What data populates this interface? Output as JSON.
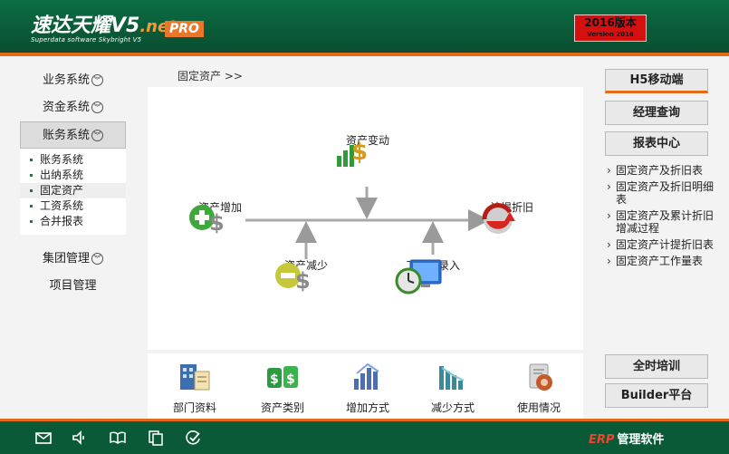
{
  "header": {
    "logo_main": "速达天耀V5",
    "logo_net": ".net",
    "logo_sub": "Superdata software Skybright V5",
    "pro_badge": "PRO",
    "version_title": "2016版本",
    "version_sub": "Version 2016"
  },
  "left_nav": {
    "items": [
      {
        "label": "业务系统"
      },
      {
        "label": "资金系统"
      },
      {
        "label": "账务系统"
      },
      {
        "label": "集团管理"
      },
      {
        "label": "项目管理"
      }
    ],
    "sub_items": [
      {
        "label": "账务系统"
      },
      {
        "label": "出纳系统"
      },
      {
        "label": "固定资产"
      },
      {
        "label": "工资系统"
      },
      {
        "label": "合并报表"
      }
    ]
  },
  "breadcrumb": "固定资产 >>",
  "flow": {
    "asset_change": "资产变动",
    "asset_increase": "资产增加",
    "depreciation": "计提折旧",
    "asset_decrease": "资产减少",
    "workload_entry": "工作量录入"
  },
  "tools": [
    {
      "label": "部门资料"
    },
    {
      "label": "资产类别"
    },
    {
      "label": "增加方式"
    },
    {
      "label": "减少方式"
    },
    {
      "label": "使用情况"
    }
  ],
  "right": {
    "h5_button": "H5移动端",
    "manager_button": "经理查询",
    "report_button": "报表中心",
    "links": [
      {
        "label": "固定资产及折旧表"
      },
      {
        "label": "固定资产及折旧明细表"
      },
      {
        "label": "固定资产及累计折旧增减过程"
      },
      {
        "label": "固定资产计提折旧表"
      },
      {
        "label": "固定资产工作量表"
      }
    ],
    "training_button": "全时培训",
    "builder_button": "Builder平台"
  },
  "footer": {
    "erp": "ERP",
    "brand": "管理软件"
  },
  "colors": {
    "header_green": "#0a5a38",
    "accent_orange": "#e46a1a",
    "version_red": "#d41010"
  }
}
